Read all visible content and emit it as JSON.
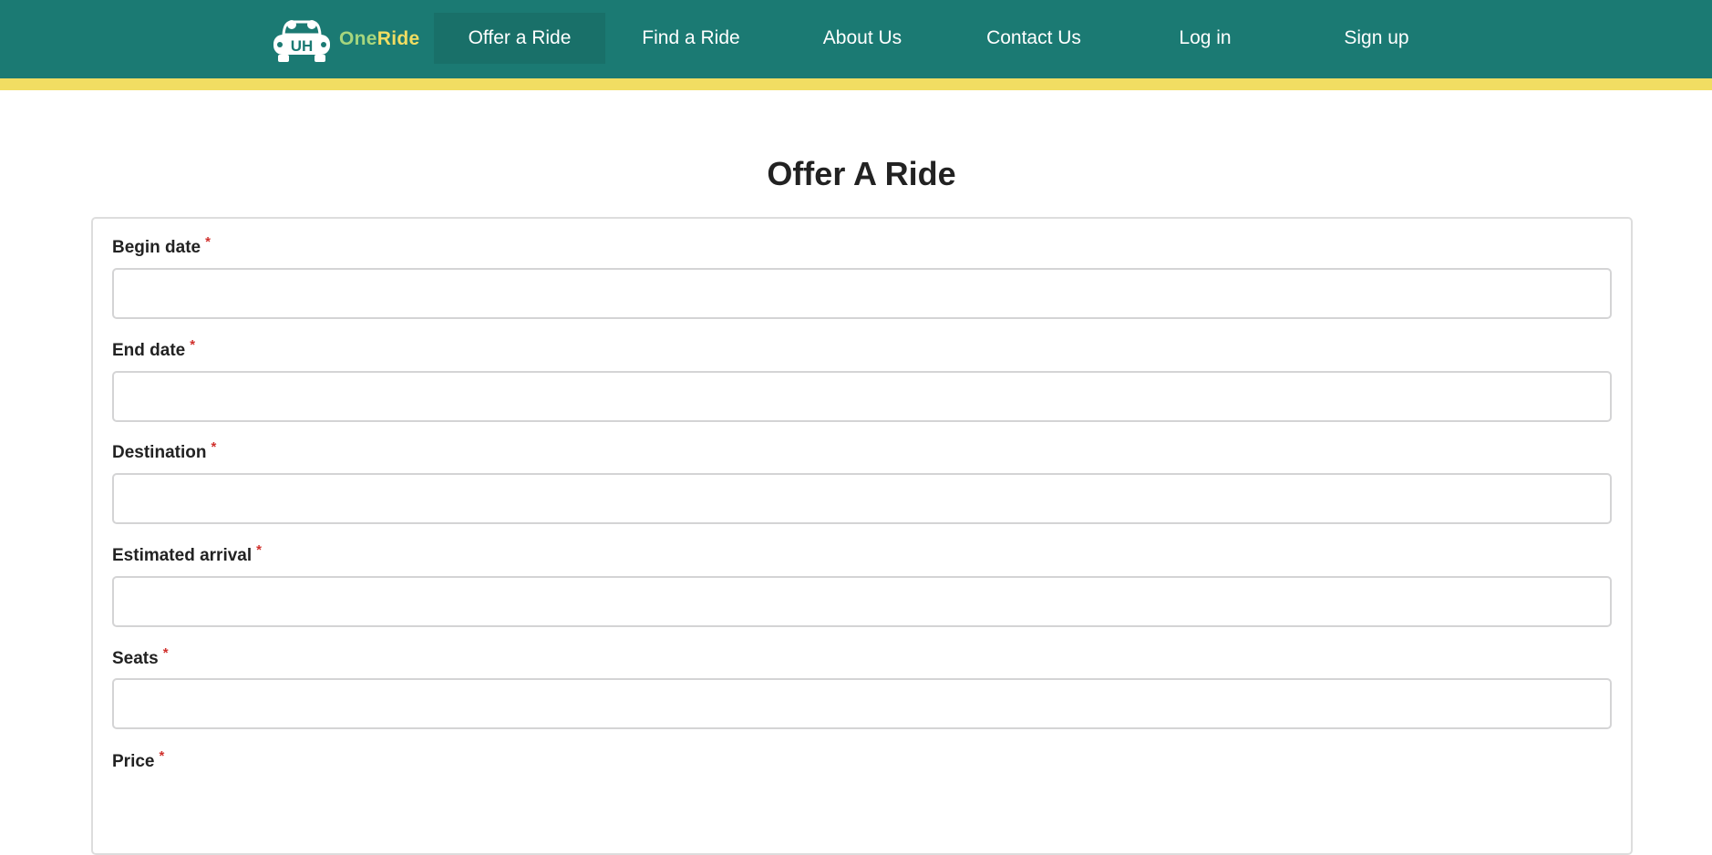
{
  "brand": {
    "logo_text": "UH",
    "name_part1": "One",
    "name_part2": "Ride"
  },
  "nav": {
    "items": [
      {
        "label": "Offer a Ride",
        "active": true
      },
      {
        "label": "Find a Ride",
        "active": false
      },
      {
        "label": "About Us",
        "active": false
      },
      {
        "label": "Contact Us",
        "active": false
      },
      {
        "label": "Log in",
        "active": false
      },
      {
        "label": "Sign up",
        "active": false
      }
    ]
  },
  "page": {
    "title": "Offer A Ride"
  },
  "form": {
    "required_marker": "*",
    "fields": [
      {
        "label": "Begin date",
        "value": "",
        "placeholder": ""
      },
      {
        "label": "End date",
        "value": "",
        "placeholder": ""
      },
      {
        "label": "Destination",
        "value": "",
        "placeholder": ""
      },
      {
        "label": "Estimated arrival",
        "value": "",
        "placeholder": ""
      },
      {
        "label": "Seats",
        "value": "",
        "placeholder": ""
      },
      {
        "label": "Price",
        "value": "",
        "placeholder": ""
      }
    ]
  },
  "colors": {
    "navbar": "#1b7a73",
    "nav_active": "#197069",
    "stripe": "#f1dd62",
    "brand_one": "#a6d67e",
    "brand_ride": "#f1dd62",
    "required": "#d0312d"
  }
}
